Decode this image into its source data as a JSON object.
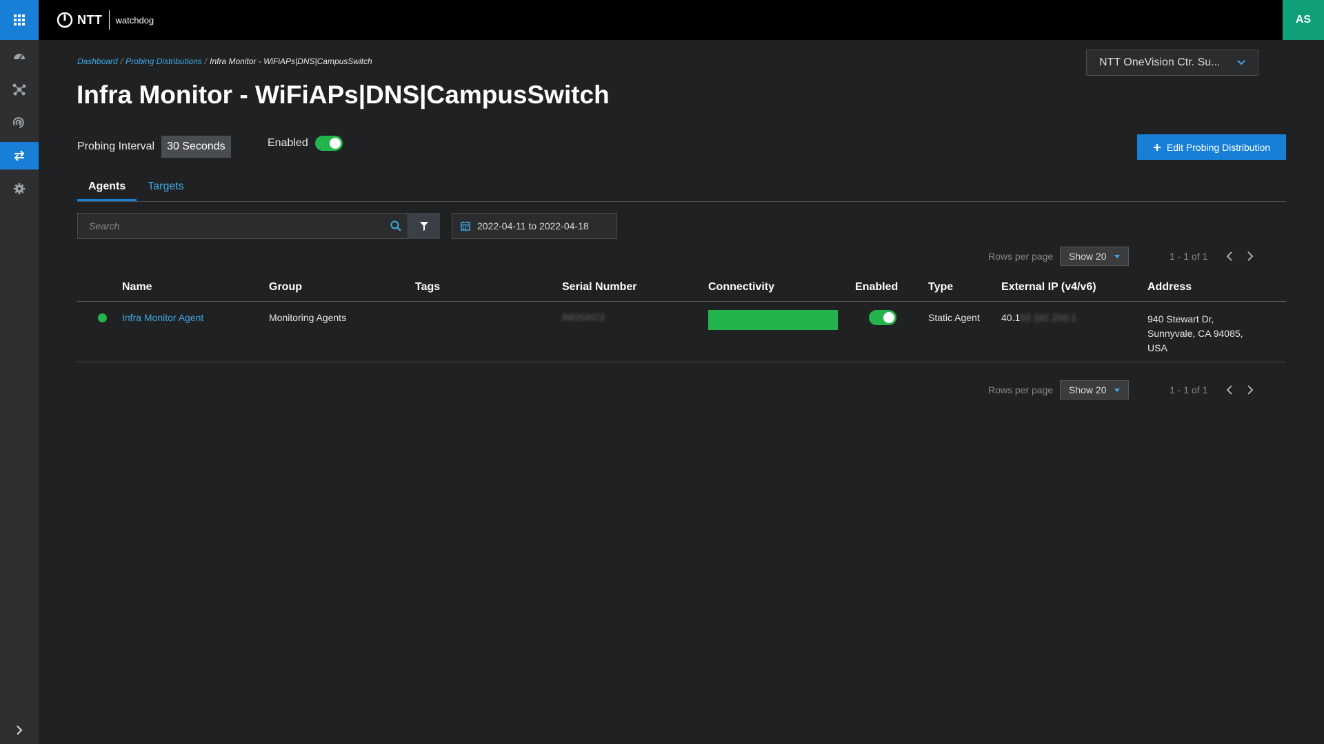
{
  "header": {
    "brand": "NTT",
    "app_name": "watchdog",
    "user_initials": "AS"
  },
  "breadcrumb": {
    "items": [
      "Dashboard",
      "Probing Distributions"
    ],
    "current": "Infra Monitor - WiFiAPs|DNS|CampusSwitch"
  },
  "account_selector": {
    "value": "NTT OneVision Ctr. Su..."
  },
  "page": {
    "title": "Infra Monitor - WiFiAPs|DNS|CampusSwitch",
    "probing_interval_label": "Probing Interval",
    "probing_interval_value": "30 Seconds",
    "enabled_label": "Enabled",
    "enabled": true,
    "edit_button_label": "Edit Probing Distribution"
  },
  "tabs": [
    {
      "label": "Agents",
      "active": true
    },
    {
      "label": "Targets",
      "active": false
    }
  ],
  "search": {
    "placeholder": "Search"
  },
  "date_range": {
    "value": "2022-04-11 to 2022-04-18"
  },
  "pagination": {
    "rows_per_page_label": "Rows per page",
    "show_value": "Show 20",
    "range": "1 - 1 of 1"
  },
  "table": {
    "columns": [
      "Name",
      "Group",
      "Tags",
      "Serial Number",
      "Connectivity",
      "Enabled",
      "Type",
      "External IP (v4/v6)",
      "Address"
    ],
    "rows": [
      {
        "status": "online",
        "name": "Infra Monitor Agent",
        "group": "Monitoring Agents",
        "tags": "",
        "serial": "8W2GKC2",
        "connectivity": 1.0,
        "enabled": true,
        "type": "Static Agent",
        "ip_visible": "40.1",
        "ip_redacted": "52.181.250.1",
        "address_line1": "940 Stewart Dr,",
        "address_line2": "Sunnyvale, CA 94085,",
        "address_line3": "USA"
      }
    ]
  },
  "colors": {
    "accent": "#1780d6",
    "link": "#3fa9e6",
    "success": "#23b54c",
    "avatar": "#0f9f79"
  }
}
